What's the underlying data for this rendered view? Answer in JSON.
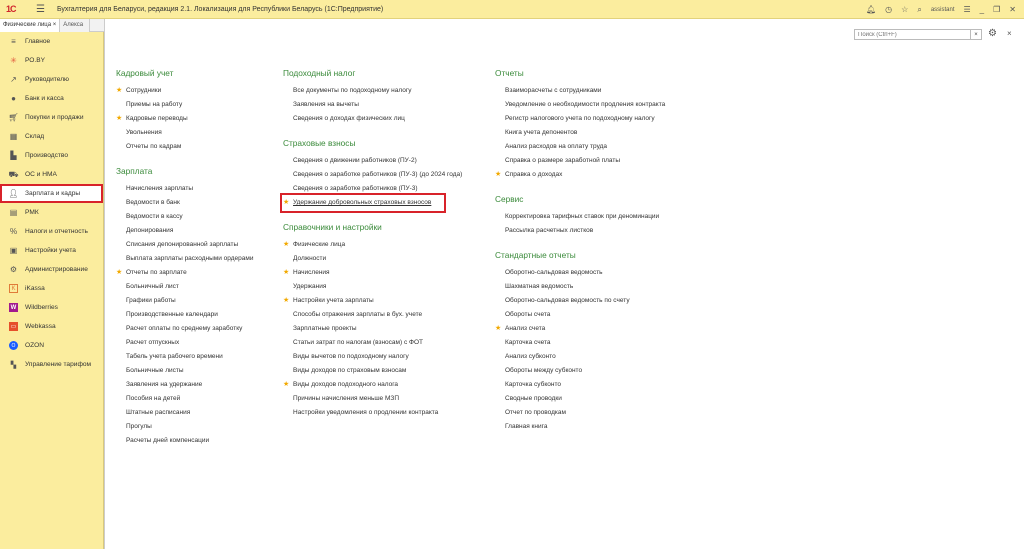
{
  "titlebar": {
    "logo": "1С",
    "title": "Бухгалтерия для Беларуси, редакция 2.1. Локализация для Республики Беларусь   (1С:Предприятие)",
    "user": "assistant"
  },
  "tabs": [
    {
      "label": "Физические лица ×"
    },
    {
      "label": "Алекса"
    }
  ],
  "sidebar": {
    "items": [
      {
        "label": "Главное",
        "icon": "hamburger-icon"
      },
      {
        "label": "РО.BY",
        "icon": "asterisk-icon"
      },
      {
        "label": "Руководителю",
        "icon": "trend-icon"
      },
      {
        "label": "Банк и касса",
        "icon": "coin-icon"
      },
      {
        "label": "Покупки и продажи",
        "icon": "cart-icon"
      },
      {
        "label": "Склад",
        "icon": "warehouse-icon"
      },
      {
        "label": "Производство",
        "icon": "factory-icon"
      },
      {
        "label": "ОС и НМА",
        "icon": "truck-icon"
      },
      {
        "label": "Зарплата и кадры",
        "icon": "person-icon"
      },
      {
        "label": "РМК",
        "icon": "register-icon"
      },
      {
        "label": "Налоги и отчетность",
        "icon": "percent-icon"
      },
      {
        "label": "Настройки учета",
        "icon": "settings-icon"
      },
      {
        "label": "Администрирование",
        "icon": "gear-icon"
      },
      {
        "label": "iKassa",
        "icon": "ikassa-icon"
      },
      {
        "label": "Wildberries",
        "icon": "wildberries-icon"
      },
      {
        "label": "Webkassa",
        "icon": "webkassa-icon"
      },
      {
        "label": "OZON",
        "icon": "ozon-icon"
      },
      {
        "label": "Управление тарифом",
        "icon": "grid-icon"
      }
    ]
  },
  "search": {
    "placeholder": "Поиск (Ctrl+F)",
    "clear": "×"
  },
  "columns": {
    "col1": {
      "kadr": {
        "title": "Кадровый учет",
        "items": [
          "Сотрудники",
          "Приемы на работу",
          "Кадровые переводы",
          "Увольнения",
          "Отчеты по кадрам"
        ]
      },
      "zp": {
        "title": "Зарплата",
        "items": [
          "Начисления зарплаты",
          "Ведомости в банк",
          "Ведомости в кассу",
          "Депонирования",
          "Списания депонированной зарплаты",
          "Выплата зарплаты расходными ордерами",
          "Отчеты по зарплате",
          "Больничный лист",
          "Графики работы",
          "Производственные календари",
          "Расчет оплаты по среднему заработку",
          "Расчет отпускных",
          "Табель учета рабочего времени",
          "Больничные листы",
          "Заявления на удержание",
          "Пособия на детей",
          "Штатные расписания",
          "Прогулы",
          "Расчеты дней компенсации"
        ]
      }
    },
    "col2": {
      "pn": {
        "title": "Подоходный налог",
        "items": [
          "Все документы по подоходному налогу",
          "Заявления на вычеты",
          "Сведения о доходах физических лиц"
        ]
      },
      "sv": {
        "title": "Страховые взносы",
        "items": [
          "Сведения о движении работников (ПУ-2)",
          "Сведения о заработке работников (ПУ-3) (до 2024 года)",
          "Сведения о заработке работников (ПУ-3)",
          "Удержание добровольных страховых взносов"
        ]
      },
      "sn": {
        "title": "Справочники и настройки",
        "items": [
          "Физические лица",
          "Должности",
          "Начисления",
          "Удержания",
          "Настройки учета зарплаты",
          "Способы отражения зарплаты в бух. учете",
          "Зарплатные проекты",
          "Статьи затрат по налогам (взносам) с ФОТ",
          "Виды вычетов по подоходному налогу",
          "Виды доходов по страховым взносам",
          "Виды доходов подоходного налога",
          "Причины начисления меньше МЗП",
          "Настройки уведомления о продлении контракта"
        ]
      }
    },
    "col3": {
      "ot": {
        "title": "Отчеты",
        "items": [
          "Взаиморасчеты с сотрудниками",
          "Уведомление о необходимости продления контракта",
          "Регистр налогового учета по подоходному налогу",
          "Книга учета депонентов",
          "Анализ расходов на оплату труда",
          "Справка о размере заработной платы",
          "Справка о доходах"
        ]
      },
      "se": {
        "title": "Сервис",
        "items": [
          "Корректировка тарифных ставок при деноминации",
          "Рассылка расчетных листков"
        ]
      },
      "st": {
        "title": "Стандартные отчеты",
        "items": [
          "Оборотно-сальдовая ведомость",
          "Шахматная ведомость",
          "Оборотно-сальдовая ведомость по счету",
          "Обороты счета",
          "Анализ счета",
          "Карточка счета",
          "Анализ субконто",
          "Обороты между субконто",
          "Карточка субконто",
          "Сводные проводки",
          "Отчет по проводкам",
          "Главная книга"
        ]
      }
    }
  },
  "star_symbol": "★"
}
